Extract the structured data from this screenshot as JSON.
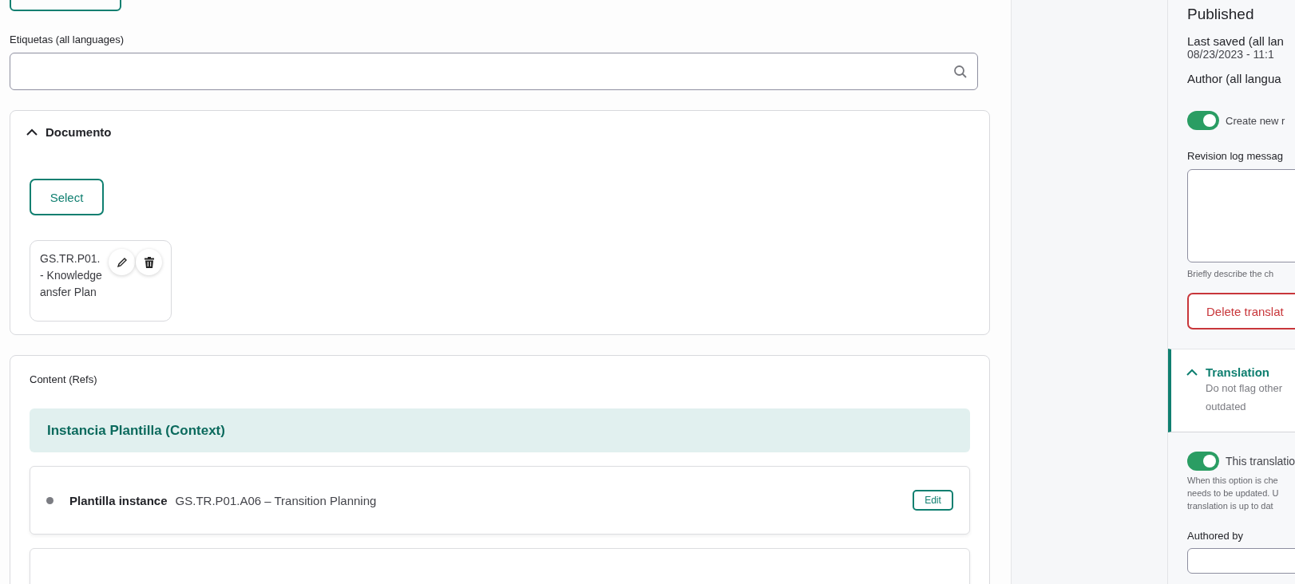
{
  "tags_field": {
    "label": "Etiquetas (all languages)"
  },
  "document": {
    "title": "Documento",
    "expanded": true,
    "select_button": "Select",
    "item": {
      "title_lines": [
        "GS.TR.P01.",
        "- Knowledge",
        "ansfer Plan"
      ]
    }
  },
  "content": {
    "label": "Content (Refs)",
    "group_title": "Instancia Plantilla (Context)",
    "rows": [
      {
        "type_label": "Plantilla instance",
        "title": "GS.TR.P01.A06 – Transition Planning",
        "edit": "Edit"
      }
    ]
  },
  "sidebar": {
    "status": "Published",
    "meta": [
      {
        "label": "Last saved (all lan",
        "value": "08/23/2023 - 11:1"
      },
      {
        "label": "Author (all langua"
      }
    ],
    "revision_toggle": {
      "label": "Create new r",
      "on": true
    },
    "revision_log": {
      "label": "Revision log messag",
      "hint": "Briefly describe the ch"
    },
    "delete_button": "Delete translat",
    "translation": {
      "title": "Translation",
      "expanded": true,
      "description": [
        "Do not flag other",
        "outdated"
      ]
    },
    "outdated_toggle": {
      "label": "This translatio",
      "on": true,
      "description": [
        "When this option is che",
        "needs to be updated. U",
        "translation is up to dat"
      ]
    },
    "authored_by": {
      "label": "Authored by"
    }
  }
}
